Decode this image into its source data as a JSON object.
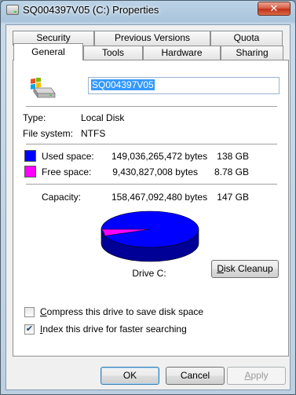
{
  "window": {
    "title": "SQ004397V05 (C:) Properties",
    "close_label": "✕"
  },
  "tabs": {
    "row1": [
      "Security",
      "Previous Versions",
      "Quota"
    ],
    "row2": [
      "General",
      "Tools",
      "Hardware",
      "Sharing"
    ],
    "active": "General"
  },
  "general": {
    "volume_name": "SQ004397V05",
    "type_label": "Type:",
    "type_value": "Local Disk",
    "fs_label": "File system:",
    "fs_value": "NTFS",
    "used": {
      "label": "Used space:",
      "bytes": "149,036,265,472 bytes",
      "size": "138 GB",
      "color": "#0000ff"
    },
    "free": {
      "label": "Free space:",
      "bytes": "9,430,827,008 bytes",
      "size": "8.78 GB",
      "color": "#ff00ff"
    },
    "capacity": {
      "label": "Capacity:",
      "bytes": "158,467,092,480 bytes",
      "size": "147 GB"
    },
    "used_fraction": 0.9405,
    "drive_label": "Drive C:",
    "disk_cleanup": {
      "pre": "",
      "key": "D",
      "post": "isk Cleanup"
    },
    "compress": {
      "pre": "",
      "key": "C",
      "post": "ompress this drive to save disk space",
      "checked": false
    },
    "index": {
      "pre": "",
      "key": "I",
      "post": "ndex this drive for faster searching",
      "checked": true
    }
  },
  "buttons": {
    "ok": "OK",
    "cancel": "Cancel",
    "apply": {
      "pre": "",
      "key": "A",
      "post": "pply"
    }
  }
}
